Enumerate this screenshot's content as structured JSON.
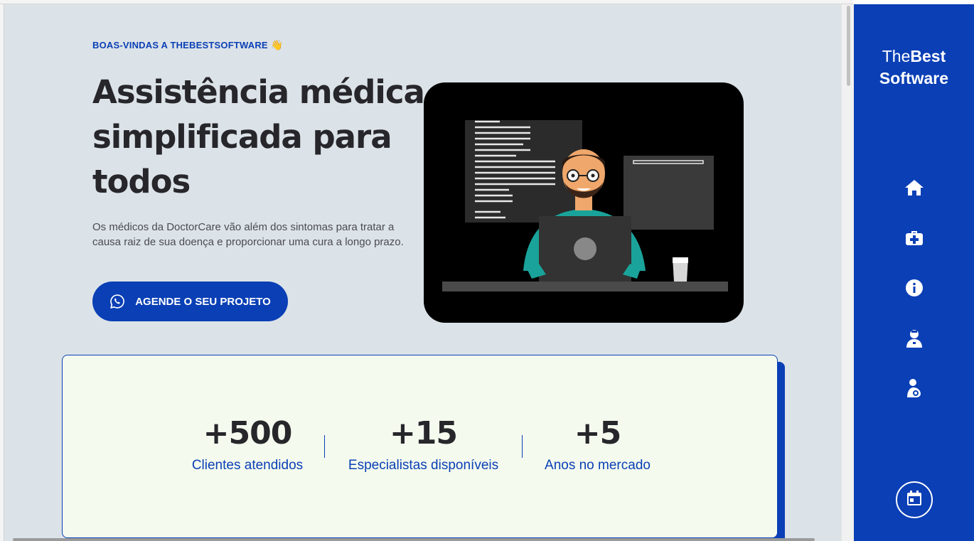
{
  "hero": {
    "eyebrow": "BOAS-VINDAS A THEBESTSOFTWARE",
    "eyebrow_emoji": "👋",
    "headline": "Assistência médica simplificada para todos",
    "lead": "Os médicos da DoctorCare vão além dos sintomas para tratar a causa raiz de sua doença e proporcionar uma cura a longo prazo.",
    "cta_label": "AGENDE O SEU PROJETO",
    "cta_icon": "whatsapp-icon"
  },
  "stats": [
    {
      "value": "+500",
      "label": "Clientes atendidos"
    },
    {
      "value": "+15",
      "label": "Especialistas disponíveis"
    },
    {
      "value": "+5",
      "label": "Anos no mercado"
    }
  ],
  "sidebar": {
    "logo_thin": "The",
    "logo_bold1": "Best",
    "logo_bold2": "Software",
    "nav": [
      "home-icon",
      "medkit-icon",
      "info-icon",
      "doctor-icon",
      "baby-care-icon"
    ],
    "action": "calendar-icon"
  },
  "colors": {
    "brand": "#0a3fb5",
    "background": "#dce3e8",
    "card": "#f4fbee",
    "text": "#26262b"
  }
}
